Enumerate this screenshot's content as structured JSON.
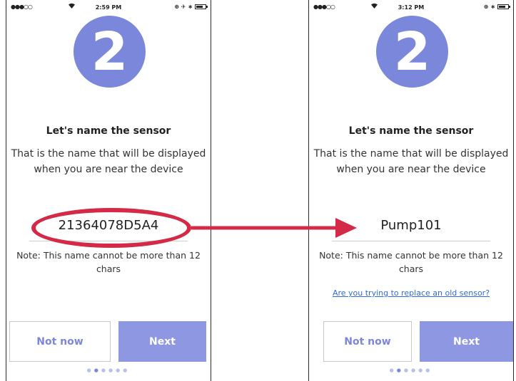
{
  "colors": {
    "accent": "#7b87db",
    "annotation": "#d42a48",
    "link": "#2f6bd8"
  },
  "left_screen": {
    "status": {
      "signal": "●●●○○",
      "time": "2:59 PM",
      "right_icons": "⊕ ✈ ∗"
    },
    "step_number": "2",
    "title": "Let's name the sensor",
    "description": "That is the name that will be displayed when you are near the device",
    "sensor_name": "21364078D5A4",
    "note": "Note: This name cannot be more than 12 chars",
    "buttons": {
      "secondary": "Not now",
      "primary": "Next"
    },
    "page_dots": {
      "total": 6,
      "active": 2
    }
  },
  "right_screen": {
    "status": {
      "signal": "●●●○○",
      "time": "3:12 PM",
      "right_icons": "⊕ ∗"
    },
    "step_number": "2",
    "title": "Let's name the sensor",
    "description": "That is the name that will be displayed when you are near the device",
    "sensor_name": "Pump101",
    "note": "Note: This name cannot be more than 12 chars",
    "replace_link": "Are you trying to replace an old sensor?",
    "buttons": {
      "secondary": "Not now",
      "primary": "Next"
    },
    "page_dots": {
      "total": 6,
      "active": 2
    }
  },
  "icons": {
    "wifi": "wifi-icon",
    "battery": "battery-icon",
    "arrow": "arrow-right-icon"
  }
}
